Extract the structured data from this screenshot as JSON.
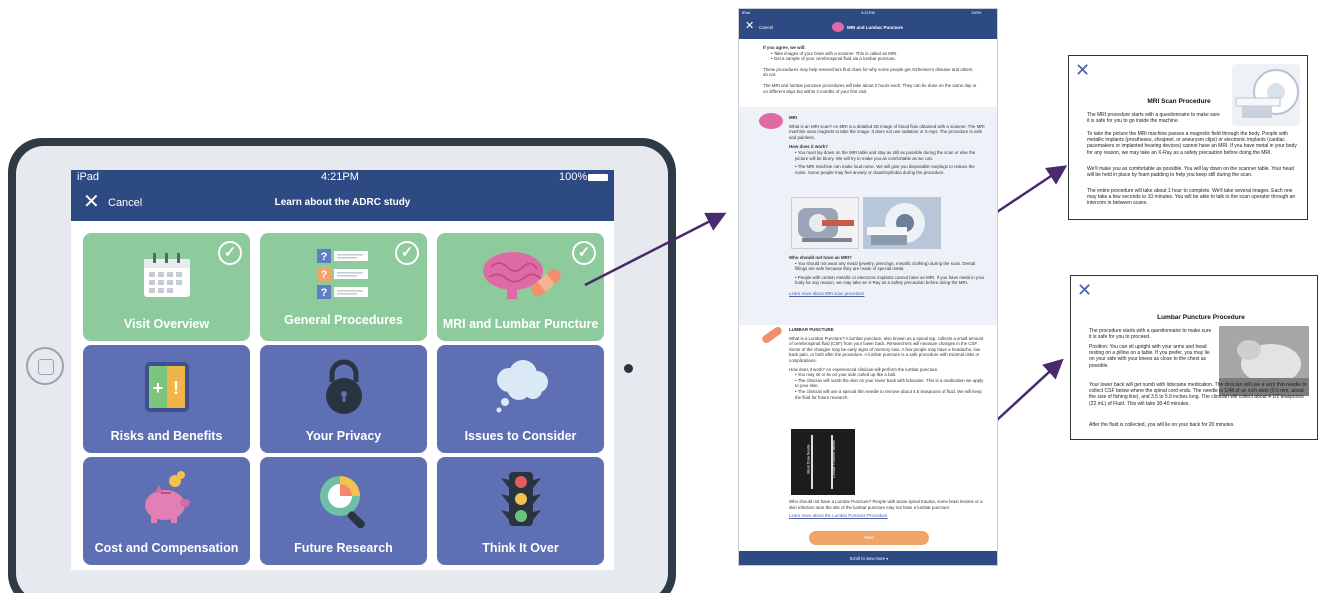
{
  "ipad": {
    "device_label": "iPad",
    "time": "4:21PM",
    "battery": "100%",
    "cancel_label": "Cancel",
    "title": "Learn about the ADRC study",
    "tiles": [
      {
        "label": "Visit Overview",
        "color": "green",
        "completed": true,
        "icon": "calendar-icon"
      },
      {
        "label": "General Procedures",
        "color": "green",
        "completed": true,
        "icon": "checklist-icon"
      },
      {
        "label": "MRI and Lumbar Puncture",
        "color": "green",
        "completed": true,
        "icon": "brain-bandage-icon"
      },
      {
        "label": "Risks and Benefits",
        "color": "blue",
        "completed": false,
        "icon": "plus-exclamation-icon"
      },
      {
        "label": "Your Privacy",
        "color": "blue",
        "completed": false,
        "icon": "lock-icon"
      },
      {
        "label": "Issues to Consider",
        "color": "blue",
        "completed": false,
        "icon": "thought-cloud-icon"
      },
      {
        "label": "Cost and Compensation",
        "color": "blue",
        "completed": false,
        "icon": "piggy-bank-icon"
      },
      {
        "label": "Future Research",
        "color": "blue",
        "completed": false,
        "icon": "magnifier-chart-icon"
      },
      {
        "label": "Think It Over",
        "color": "blue",
        "completed": false,
        "icon": "traffic-light-icon"
      }
    ]
  },
  "phone": {
    "device_label": "iPad",
    "time": "4:21PM",
    "battery": "100%",
    "cancel_label": "Cancel",
    "title": "MRI and Lumbar Puncture",
    "intro_heading": "If you agree, we will:",
    "intro_bullets": [
      "Take images of your brain with a scanner. This is called an MRI.",
      "Get a sample of your cerebrospinal fluid via a lumbar puncture."
    ],
    "intro_p1": "These procedures may help researchers find clues for why some people get Alzheimer's disease and others do not.",
    "intro_p2": "The MRI and lumbar puncture procedures will take about 2 hours each. They can be done on the same day or on different days but within 3 months of your first visit.",
    "mri_label": "MRI",
    "mri_what": "What is an MRI scan? An MRI is a detailed 3D image of blood flow obtained with a scanner. The MRI machine uses magnets to take the image. It does not use radiation or X-rays. The procedure is safe and painless.",
    "mri_how_heading": "How does it work?",
    "mri_how_bullets": [
      "You must lay down on the MRI table and stay as still as possible during the scan or else the picture will be blurry. We will try to make you as comfortable as we can.",
      "The MRI machine can make loud noise. We will give you disposable earplugs to reduce the noise. Some people may feel anxiety or claustrophobia during the procedure."
    ],
    "mri_who_heading": "Who should not have an MRI?",
    "mri_who_bullets": [
      "You should not wear any metal (jewelry, piercings, metallic clothing) during the scan. Dental fillings are safe because they are made of special metal.",
      "People with certain metallic or electronic implants cannot have an MRI. If you have metal in your body for any reason, we may take an X-Ray as a safety precaution before doing the MRI."
    ],
    "mri_link": "Learn more about MRI scan procedure",
    "lp_label": "LUMBAR PUNCTURE",
    "lp_what": "What is a Lumbar Puncture? A lumbar puncture, also known as a spinal tap, collects a small amount of cerebrospinal fluid (CSF) from your lower back. Researchers will measure changes in the CSF. Some of the changes may be early signs of memory loss. A few people may have a headache, low back pain, or both after the procedure. A lumbar puncture is a safe procedure with minimal risks or complications.",
    "lp_how": "How does it work? An experienced clinician will perform the lumbar puncture.",
    "lp_bullets": [
      "You may sit or lie on your side curled up like a ball.",
      "The clinician will numb the skin on your lower back with lidocaine. This is a medication we apply to your skin.",
      "The clinician will use a special thin needle to remove about 4.5 teaspoons of fluid. We will keep the fluid for future research."
    ],
    "needle_labels": [
      "Blood Draw Needle",
      "Lumbar Puncture Needle"
    ],
    "lp_who": "Who should not have a Lumbar Puncture? People with acute spinal trauma, some brain lesions or a skin infection near the site of the lumbar puncture may not have a lumbar puncture.",
    "lp_link": "Learn more about the Lumbar Puncture Procedure",
    "next_label": "Next",
    "footer_label": "Scroll to view more"
  },
  "mri_card": {
    "close_icon": "close-icon",
    "title": "MRI Scan Procedure",
    "p1": "The MRI procedure starts with a questionnaire to make sure it is safe for you to go inside the machine.",
    "p2": "To take the picture the MRI machine passes a magnetic field through the body. People with metallic implants (prostheses, shrapnel, or aneurysm clips) or electronic implants (cardiac pacemakers or implanted hearing devices) cannot have an MRI. If you have metal in your body for any reason, we may take an X-Ray as a safety precaution before doing the MRI.",
    "p3": "We'll make you as comfortable as possible. You will lay down on the scanner table. Your head will be held in place by foam padding to help you keep still during the scan.",
    "p4": "The entire procedure will take about 1 hour to complete. We'll take several images. Each one may take a few seconds to 10 minutes. You will be able to talk to the scan operator through an intercom in between scans."
  },
  "lp_card": {
    "close_icon": "close-icon",
    "title": "Lumbar Puncture Procedure",
    "p1": "The procedure starts with a questionnaire to make sure it is safe for you to proceed.",
    "p2": "Position: You can sit upright with your arms and head resting on a pillow on a table. If you prefer, you may lie on your side with your knees as close to the chest as possible.",
    "p3": "Your lower back will get numb with lidocaine medication. The clinician will use a very thin needle to collect CSF below where the spinal cord ends. The needle is 1/48 of an inch wide (0.5 mm, about the size of fishing line), and 3.5 to 5.9 inches long. The clinician will collect about 4 1/2 teaspoons (22 mL) of Fluid. This will take 30-40 minutes.",
    "p4": "After the fluid is collected, you will lie on your back for 20 minutes."
  },
  "colors": {
    "nav_blue": "#2e4a83",
    "tile_green": "#8dcb9d",
    "tile_blue": "#5f6fb3",
    "arrow_purple": "#4a2a6e",
    "next_orange": "#f0a467"
  }
}
